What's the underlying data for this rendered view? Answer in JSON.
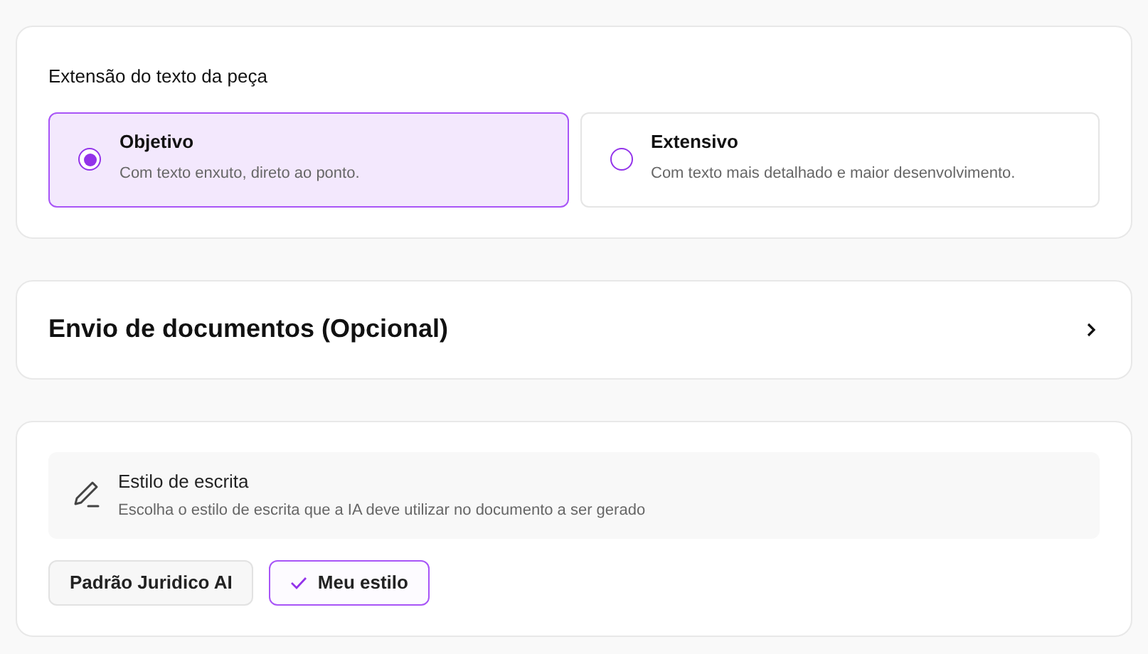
{
  "length_section": {
    "title": "Extensão do texto da peça",
    "options": [
      {
        "label": "Objetivo",
        "description": "Com texto enxuto, direto ao ponto.",
        "selected": true
      },
      {
        "label": "Extensivo",
        "description": "Com texto mais detalhado e maior desenvolvimento.",
        "selected": false
      }
    ]
  },
  "documents_section": {
    "title": "Envio de documentos (Opcional)",
    "expanded": false
  },
  "style_section": {
    "title": "Estilo de escrita",
    "description": "Escolha o estilo de escrita que a IA deve utilizar no documento a ser gerado",
    "options": [
      {
        "label": "Padrão Juridico AI",
        "selected": false
      },
      {
        "label": "Meu estilo",
        "selected": true
      }
    ]
  }
}
